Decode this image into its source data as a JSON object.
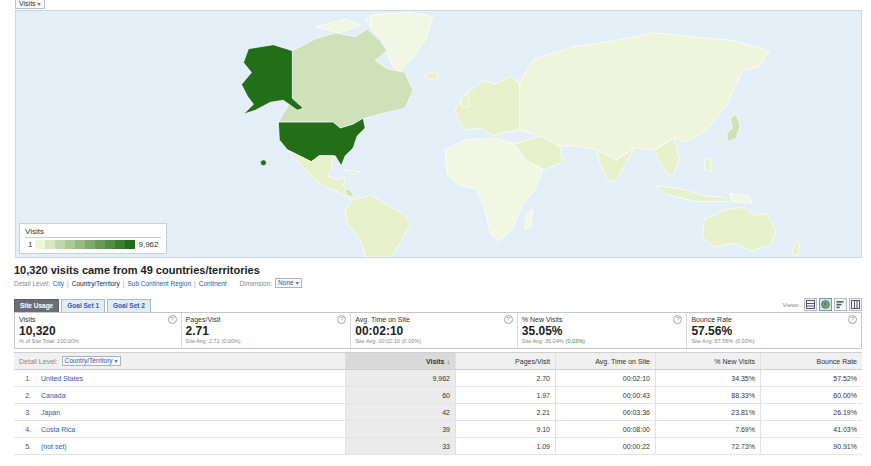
{
  "metric_select": {
    "label": "Visits",
    "arrow": "▾"
  },
  "map": {
    "legend": {
      "title": "Visits",
      "min": "1",
      "max": "9,962"
    }
  },
  "heading": "10,320 visits came from 49 countries/territories",
  "detail_level": {
    "label": "Detail Level:",
    "separator": "|",
    "options": [
      {
        "label": "City",
        "selected": false
      },
      {
        "label": "Country/Territory",
        "selected": true
      },
      {
        "label": "Sub Continent Region",
        "selected": false
      },
      {
        "label": "Continent",
        "selected": false
      }
    ]
  },
  "dimension": {
    "label": "Dimension:",
    "value": "None",
    "arrow": "▾"
  },
  "tabs": [
    {
      "label": "Site Usage",
      "selected": true
    },
    {
      "label": "Goal Set 1",
      "selected": false
    },
    {
      "label": "Goal Set 2",
      "selected": false
    }
  ],
  "views": {
    "label": "Views:",
    "buttons": [
      {
        "selected": false
      },
      {
        "selected": true
      },
      {
        "selected": false
      },
      {
        "selected": false
      }
    ]
  },
  "help_icon": "?",
  "summary": [
    {
      "label": "Visits",
      "value": "10,320",
      "note": "% of Site Total: 100.00%"
    },
    {
      "label": "Pages/Visit",
      "value": "2.71",
      "note": "Site Avg: 2.71",
      "change": "(0.00%)",
      "change_highlight": false
    },
    {
      "label": "Avg. Time on Site",
      "value": "00:02:10",
      "note": "Site Avg: 00:02:10",
      "change": "(0.00%)",
      "change_highlight": false
    },
    {
      "label": "% New Visits",
      "value": "35.05%",
      "note": "Site Avg: 35.04%",
      "change": "(0.03%)",
      "change_highlight": true
    },
    {
      "label": "Bounce Rate",
      "value": "57.56%",
      "note": "Site Avg: 57.56%",
      "change": "(0.00%)",
      "change_highlight": false
    }
  ],
  "table": {
    "detail_select": {
      "label": "Detail Level:",
      "value": "Country/Territory",
      "arrow": "▾"
    },
    "columns": [
      {
        "label": "Visits",
        "sorted": true,
        "arrow": "↓"
      },
      {
        "label": "Pages/Visit",
        "sorted": false
      },
      {
        "label": "Avg. Time on Site",
        "sorted": false
      },
      {
        "label": "% New Visits",
        "sorted": false
      },
      {
        "label": "Bounce Rate",
        "sorted": false
      }
    ],
    "rows": [
      {
        "index": "1.",
        "country": "United States",
        "visits": "9,962",
        "pages_per_visit": "2.70",
        "avg_time": "00:02:10",
        "new_visits": "34.35%",
        "bounce_rate": "57.52%"
      },
      {
        "index": "2.",
        "country": "Canada",
        "visits": "60",
        "pages_per_visit": "1.97",
        "avg_time": "00:00:43",
        "new_visits": "88.33%",
        "bounce_rate": "60.00%"
      },
      {
        "index": "3.",
        "country": "Japan",
        "visits": "42",
        "pages_per_visit": "2.21",
        "avg_time": "00:03:36",
        "new_visits": "23.81%",
        "bounce_rate": "26.19%"
      },
      {
        "index": "4.",
        "country": "Costa Rica",
        "visits": "39",
        "pages_per_visit": "9.10",
        "avg_time": "00:08:00",
        "new_visits": "7.69%",
        "bounce_rate": "41.03%"
      },
      {
        "index": "5.",
        "country": "(not set)",
        "visits": "33",
        "pages_per_visit": "1.09",
        "avg_time": "00:00:22",
        "new_visits": "72.73%",
        "bounce_rate": "90.91%"
      }
    ]
  }
}
